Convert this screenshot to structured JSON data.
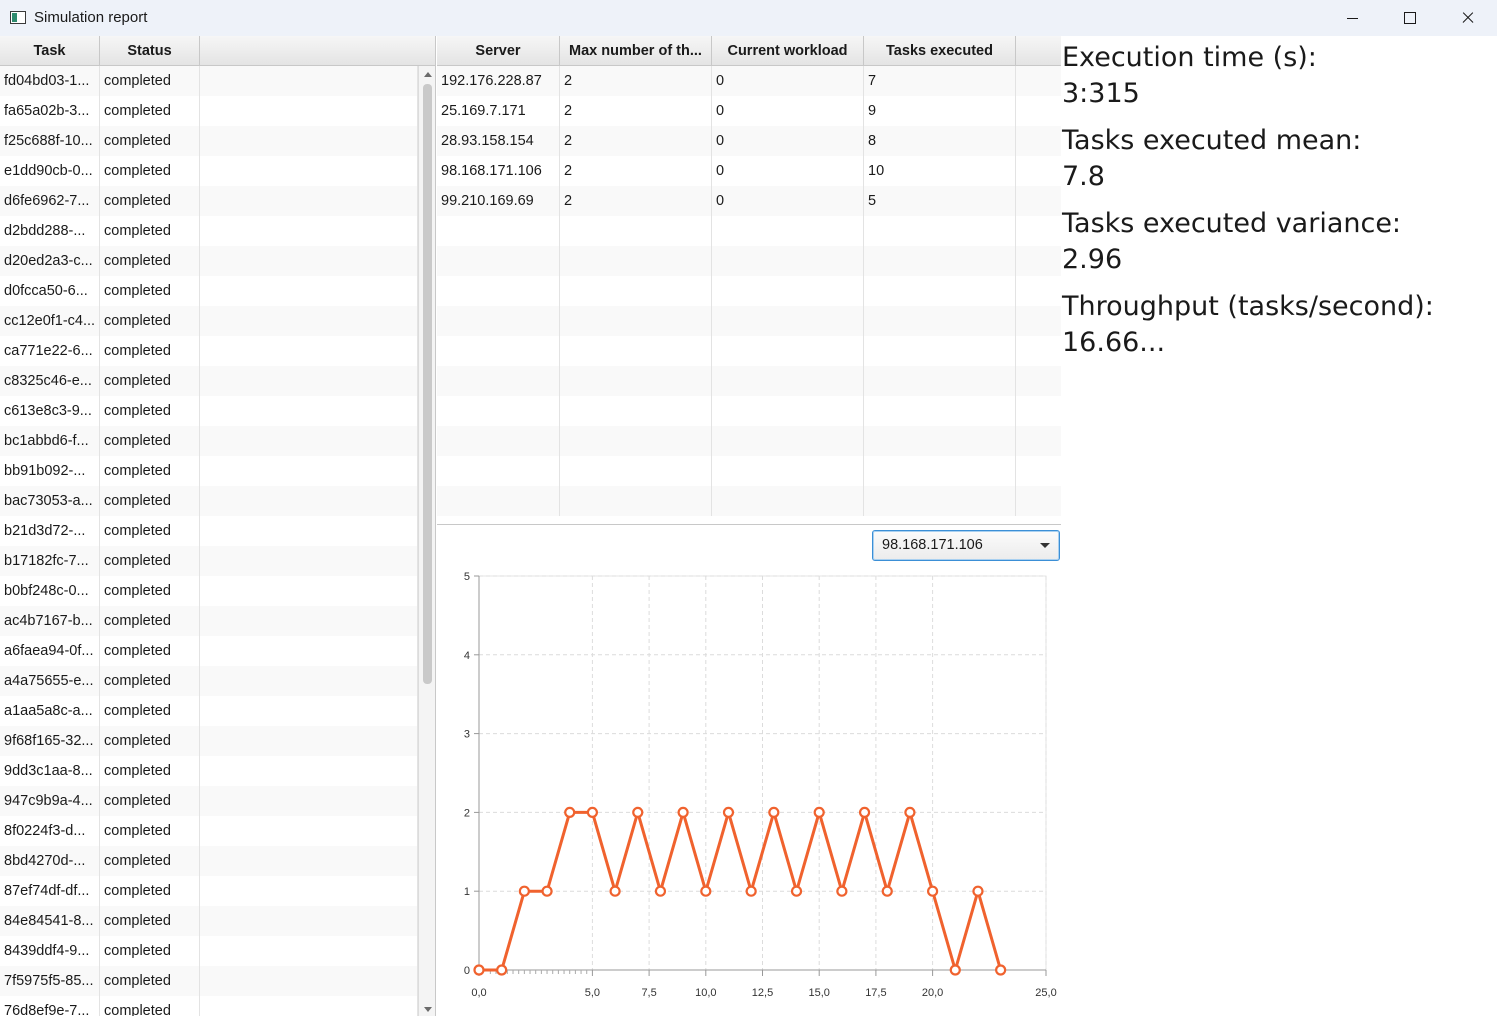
{
  "window": {
    "title": "Simulation report"
  },
  "task_table": {
    "columns": [
      "Task",
      "Status"
    ],
    "rows": [
      [
        "fd04bd03-1...",
        "completed"
      ],
      [
        "fa65a02b-3...",
        "completed"
      ],
      [
        "f25c688f-10...",
        "completed"
      ],
      [
        "e1dd90cb-0...",
        "completed"
      ],
      [
        "d6fe6962-7...",
        "completed"
      ],
      [
        "d2bdd288-...",
        "completed"
      ],
      [
        "d20ed2a3-c...",
        "completed"
      ],
      [
        "d0fcca50-6...",
        "completed"
      ],
      [
        "cc12e0f1-c4...",
        "completed"
      ],
      [
        "ca771e22-6...",
        "completed"
      ],
      [
        "c8325c46-e...",
        "completed"
      ],
      [
        "c613e8c3-9...",
        "completed"
      ],
      [
        "bc1abbd6-f...",
        "completed"
      ],
      [
        "bb91b092-...",
        "completed"
      ],
      [
        "bac73053-a...",
        "completed"
      ],
      [
        "b21d3d72-...",
        "completed"
      ],
      [
        "b17182fc-7...",
        "completed"
      ],
      [
        "b0bf248c-0...",
        "completed"
      ],
      [
        "ac4b7167-b...",
        "completed"
      ],
      [
        "a6faea94-0f...",
        "completed"
      ],
      [
        "a4a75655-e...",
        "completed"
      ],
      [
        "a1aa5a8c-a...",
        "completed"
      ],
      [
        "9f68f165-32...",
        "completed"
      ],
      [
        "9dd3c1aa-8...",
        "completed"
      ],
      [
        "947c9b9a-4...",
        "completed"
      ],
      [
        "8f0224f3-d...",
        "completed"
      ],
      [
        "8bd4270d-...",
        "completed"
      ],
      [
        "87ef74df-df...",
        "completed"
      ],
      [
        "84e84541-8...",
        "completed"
      ],
      [
        "8439ddf4-9...",
        "completed"
      ],
      [
        "7f5975f5-85...",
        "completed"
      ],
      [
        "76d8ef9e-7...",
        "completed"
      ]
    ]
  },
  "server_table": {
    "columns": [
      "Server",
      "Max number of th...",
      "Current workload",
      "Tasks executed"
    ],
    "rows": [
      [
        "192.176.228.87",
        "2",
        "0",
        "7"
      ],
      [
        "25.169.7.171",
        "2",
        "0",
        "9"
      ],
      [
        "28.93.158.154",
        "2",
        "0",
        "8"
      ],
      [
        "98.168.171.106",
        "2",
        "0",
        "10"
      ],
      [
        "99.210.169.69",
        "2",
        "0",
        "5"
      ]
    ]
  },
  "server_select": {
    "selected": "98.168.171.106"
  },
  "stats": {
    "execution_time_label": "Execution time (s):",
    "execution_time_value": "3:315",
    "mean_label": "Tasks executed mean:",
    "mean_value": "7.8",
    "variance_label": "Tasks executed variance:",
    "variance_value": "2.96",
    "throughput_label": "Throughput (tasks/second):",
    "throughput_value": "16.66..."
  },
  "chart_data": {
    "type": "line",
    "x": [
      0,
      1,
      2,
      3,
      4,
      5,
      6,
      7,
      8,
      9,
      10,
      11,
      12,
      13,
      14,
      15,
      16,
      17,
      18,
      19,
      20,
      21,
      22,
      23
    ],
    "series": [
      {
        "values": [
          0,
          0,
          1,
          1,
          2,
          2,
          1,
          2,
          1,
          2,
          1,
          2,
          1,
          2,
          1,
          2,
          1,
          2,
          1,
          2,
          1,
          0,
          1,
          0
        ]
      }
    ],
    "xlim": [
      0,
      25
    ],
    "ylim": [
      0,
      5
    ],
    "x_tick_labels": [
      "0,0",
      "5,0",
      "7,5",
      "10,0",
      "12,5",
      "15,0",
      "17,5",
      "20,0",
      "25,0"
    ],
    "x_tick_values": [
      0,
      5,
      7.5,
      10,
      12.5,
      15,
      17.5,
      20,
      25
    ],
    "y_tick_labels": [
      "0",
      "1",
      "2",
      "3",
      "4",
      "5"
    ],
    "y_tick_values": [
      0,
      1,
      2,
      3,
      4,
      5
    ],
    "grid": true,
    "line_color": "#f0622e"
  }
}
